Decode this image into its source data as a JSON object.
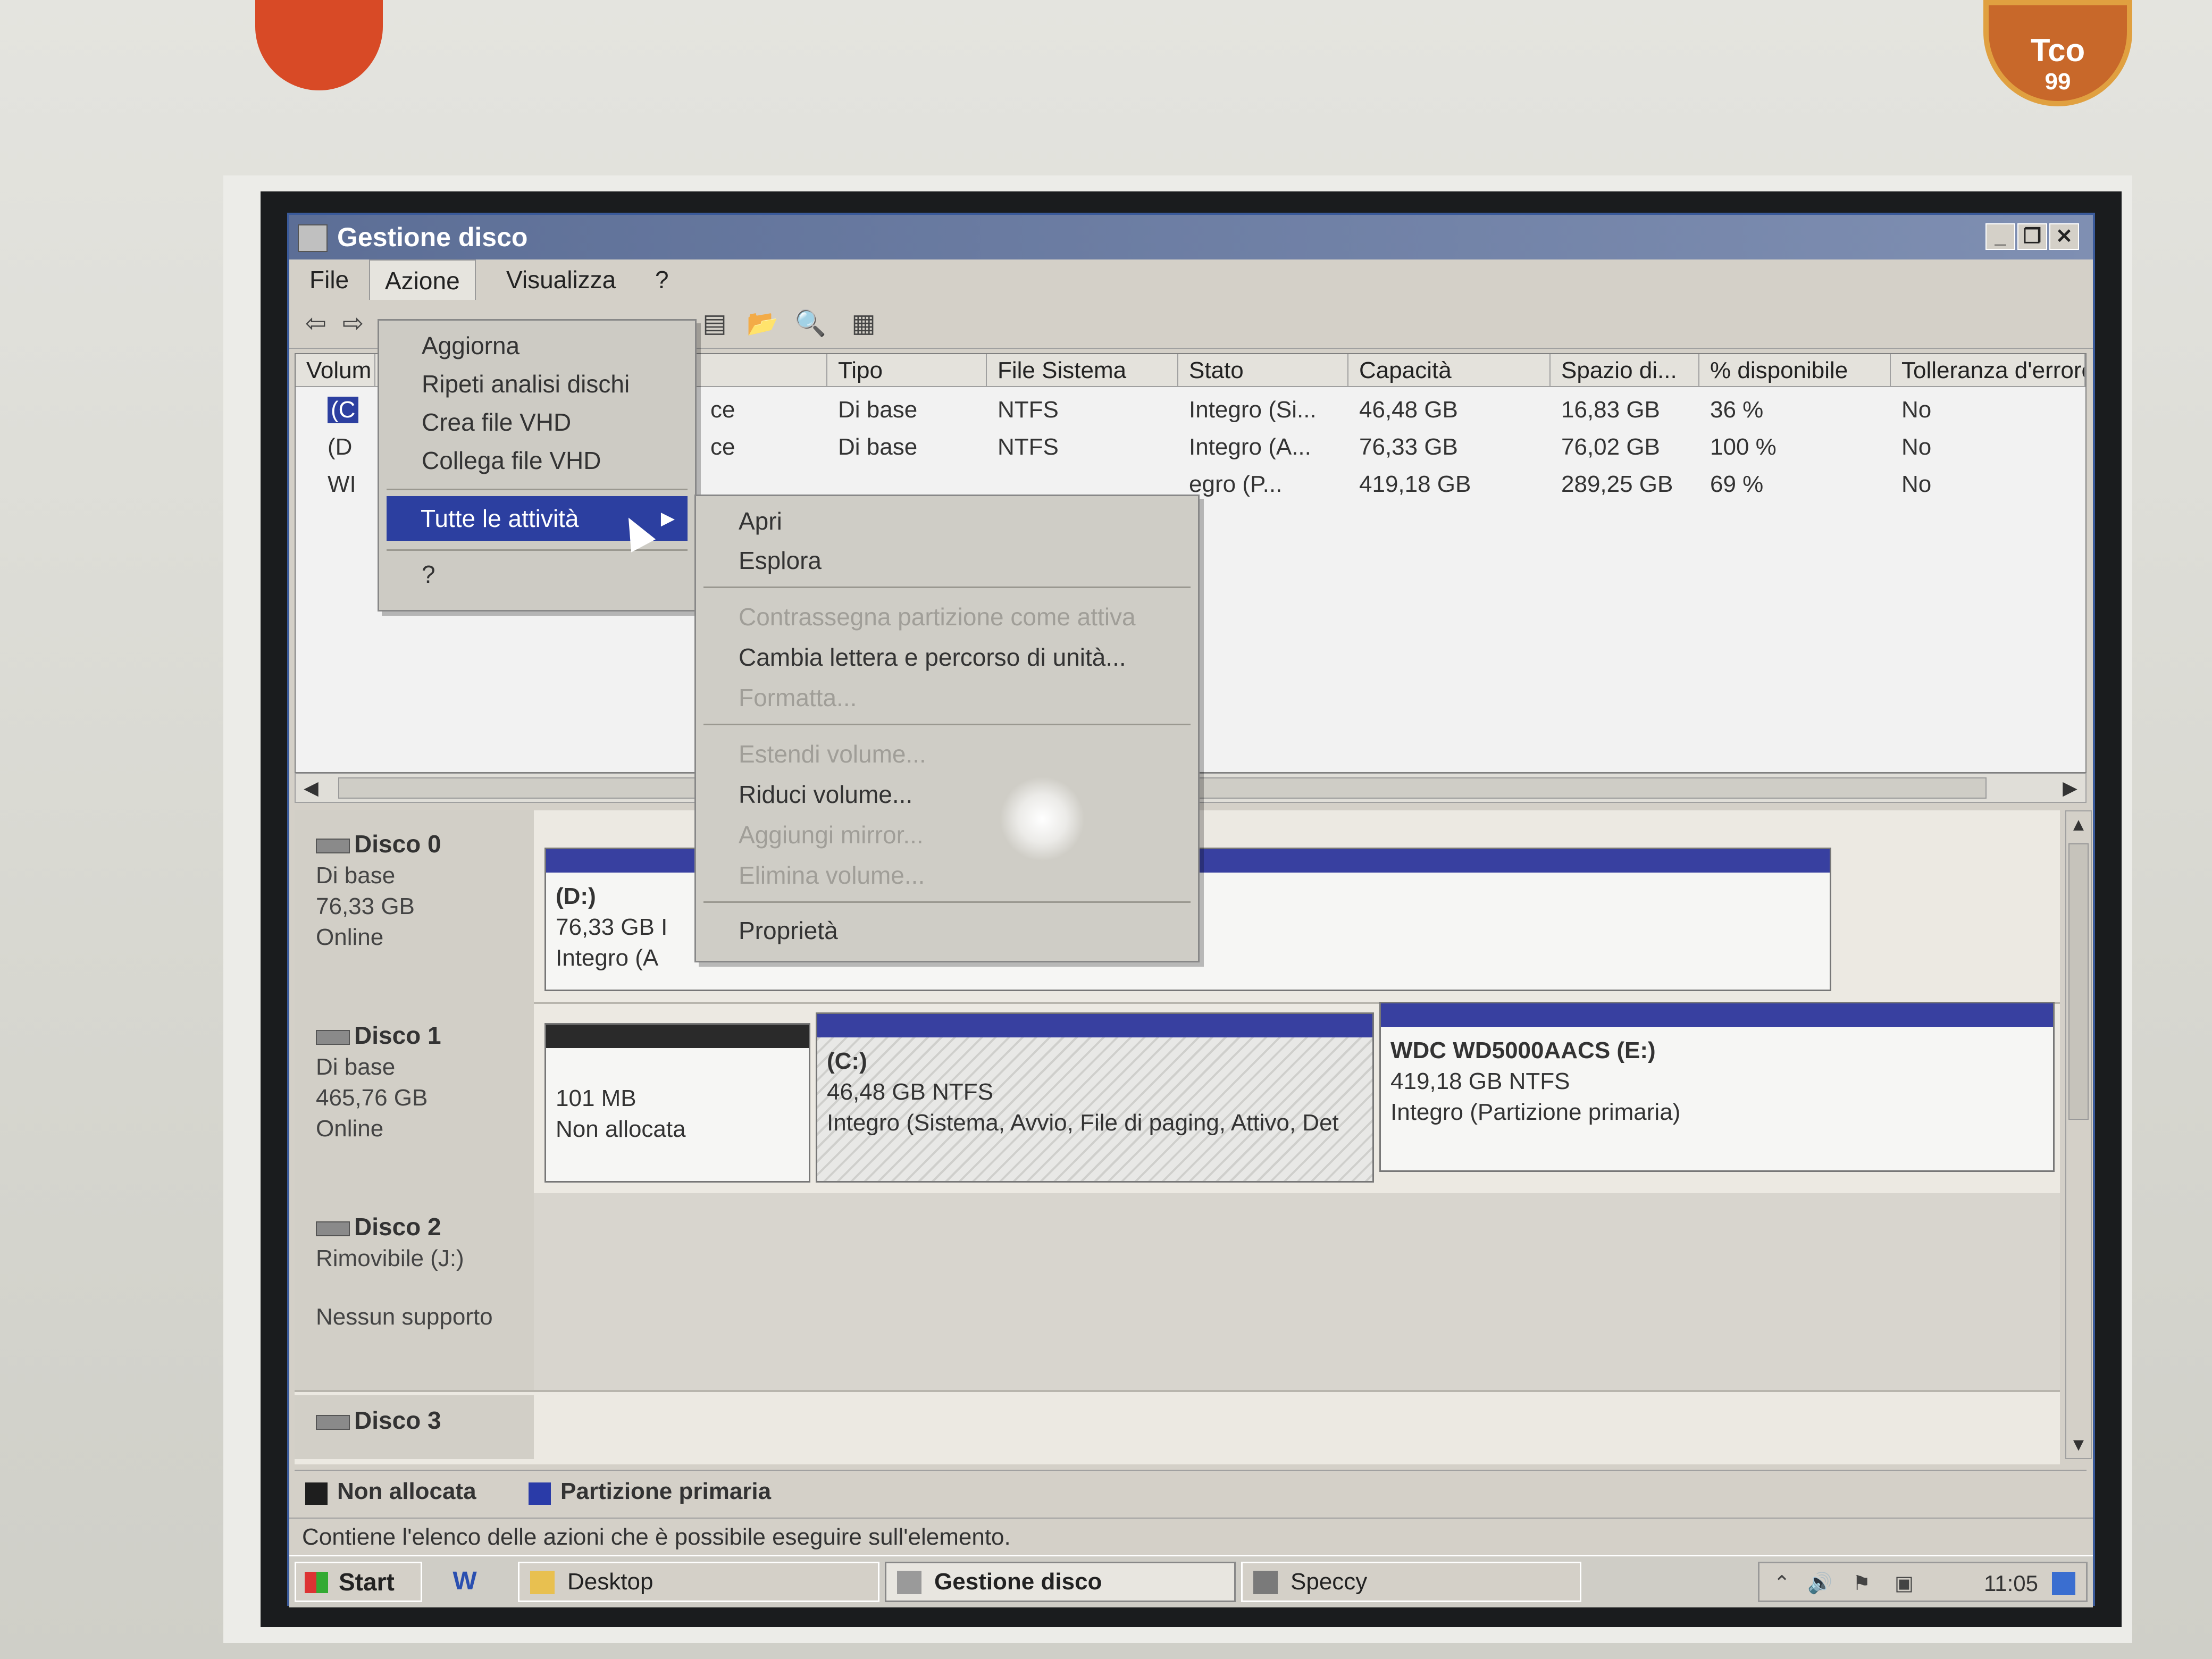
{
  "window": {
    "title": "Gestione disco",
    "controls": [
      "_",
      "❐",
      "✕"
    ]
  },
  "menubar": {
    "items": [
      "File",
      "Azione",
      "Visualizza",
      "?"
    ]
  },
  "action_menu": {
    "items": [
      "Aggiorna",
      "Ripeti analisi dischi",
      "Crea file VHD",
      "Collega file VHD",
      "Tutte le attività",
      "?"
    ],
    "submenu_arrow": "▶"
  },
  "submenu": {
    "items": [
      {
        "label": "Apri",
        "enabled": true
      },
      {
        "label": "Esplora",
        "enabled": true
      },
      {
        "label": "Contrassegna partizione come attiva",
        "enabled": false
      },
      {
        "label": "Cambia lettera e percorso di unità...",
        "enabled": true
      },
      {
        "label": "Formatta...",
        "enabled": false
      },
      {
        "label": "Estendi volume...",
        "enabled": false
      },
      {
        "label": "Riduci volume...",
        "enabled": true
      },
      {
        "label": "Aggiungi mirror...",
        "enabled": false
      },
      {
        "label": "Elimina volume...",
        "enabled": false
      },
      {
        "label": "Proprietà",
        "enabled": true
      }
    ]
  },
  "volume_list": {
    "columns": [
      "Volum",
      "t",
      "Tipo",
      "File Sistema",
      "Stato",
      "Capacità",
      "Spazio di...",
      "% disponibile",
      "Tolleranza d'errore"
    ],
    "rows": [
      {
        "vol": "(C",
        "layout": "ce",
        "type": "Di base",
        "fs": "NTFS",
        "status": "Integro (Si...",
        "capacity": "46,48 GB",
        "free": "16,83 GB",
        "pct": "36 %",
        "fault": "No"
      },
      {
        "vol": "(D",
        "layout": "ce",
        "type": "Di base",
        "fs": "NTFS",
        "status": "Integro (A...",
        "capacity": "76,33 GB",
        "free": "76,02 GB",
        "pct": "100 %",
        "fault": "No"
      },
      {
        "vol": "WI",
        "layout": "",
        "type": "",
        "fs": "",
        "status": "egro (P...",
        "capacity": "419,18 GB",
        "free": "289,25 GB",
        "pct": "69 %",
        "fault": "No"
      }
    ]
  },
  "disks": [
    {
      "name": "Disco 0",
      "kind": "Di base",
      "size": "76,33 GB",
      "state": "Online",
      "partitions": [
        {
          "label": "(D:)",
          "line2": "76,33 GB I",
          "line3": "Integro (A"
        }
      ]
    },
    {
      "name": "Disco 1",
      "kind": "Di base",
      "size": "465,76 GB",
      "state": "Online",
      "partitions": [
        {
          "label": "",
          "line2": "101 MB",
          "line3": "Non allocata"
        },
        {
          "label": "(C:)",
          "line2": "46,48 GB NTFS",
          "line3": "Integro (Sistema, Avvio, File di paging, Attivo, Det"
        },
        {
          "label": "WDC WD5000AACS  (E:)",
          "line2": "419,18 GB NTFS",
          "line3": "Integro (Partizione primaria)"
        }
      ]
    },
    {
      "name": "Disco 2",
      "kind": "Rimovibile (J:)",
      "size": "",
      "state": "Nessun supporto",
      "partitions": []
    },
    {
      "name": "Disco 3"
    }
  ],
  "legend": {
    "items": [
      {
        "label": "Non allocata",
        "color": "#1e1e1e"
      },
      {
        "label": "Partizione primaria",
        "color": "#2a3ba8"
      }
    ]
  },
  "status": {
    "text": "Contiene l'elenco delle azioni che è possibile eseguire sull'elemento."
  },
  "taskbar": {
    "start": "Start",
    "buttons": [
      "Desktop",
      "Gestione disco",
      "Speccy"
    ],
    "clock": "11:05"
  },
  "stickers": {
    "tco_top": "Tco",
    "tco_bottom": "99"
  },
  "colors": {
    "title_bar": "#5c6e96",
    "menu_highlight": "#2c3fa0",
    "partition_bar": "#3840a0"
  }
}
